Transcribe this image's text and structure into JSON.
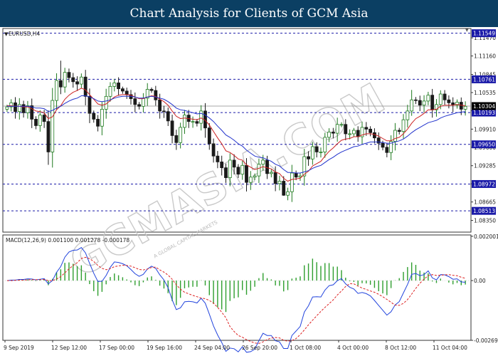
{
  "banner": {
    "title": "Chart Analysis for Clients of GCM Asia"
  },
  "watermark": {
    "text": "GCMASIA.COM",
    "subtext": "A GLOBAL CAPITAL MARKETS"
  },
  "chart_data": [
    {
      "type": "candlestick",
      "symbol_label": "EURUSD,H4",
      "ylim": [
        1.0815,
        1.1163
      ],
      "y_ticks": [
        1.1147,
        1.1116,
        1.10845,
        1.10535,
        1.10225,
        1.0991,
        1.096,
        1.09285,
        1.08975,
        1.08665,
        1.0835
      ],
      "y_tick_labels": [
        "1.11470",
        "1.11160",
        "1.10845",
        "1.10535",
        "1.10225",
        "1.09910",
        "1.09600",
        "1.09285",
        "1.08975",
        "1.08665",
        "1.08350"
      ],
      "levels": [
        {
          "value": 1.11549,
          "label": "1.11549"
        },
        {
          "value": 1.10761,
          "label": "1.10761"
        },
        {
          "value": 1.10193,
          "label": "1.10193"
        },
        {
          "value": 1.0965,
          "label": "1.09650"
        },
        {
          "value": 1.08972,
          "label": "1.08972"
        },
        {
          "value": 1.08513,
          "label": "1.08513"
        }
      ],
      "current_price": {
        "value": 1.10304,
        "label": "1.10304"
      },
      "x_labels": [
        "9 Sep 2019",
        "12 Sep 12:00",
        "17 Sep 00:00",
        "19 Sep 16:00",
        "24 Sep 04:00",
        "26 Sep 20:00",
        "1 Oct 08:00",
        "4 Oct 00:00",
        "8 Oct 12:00",
        "11 Oct 04:00"
      ],
      "closes": [
        1.1029,
        1.1036,
        1.1021,
        1.1033,
        1.1019,
        1.1031,
        1.1008,
        1.0997,
        1.1015,
        1.1004,
        1.0952,
        1.104,
        1.1074,
        1.1063,
        1.1088,
        1.1079,
        1.1072,
        1.1068,
        1.108,
        1.1047,
        1.1018,
        1.1008,
        1.0996,
        1.1025,
        1.1047,
        1.1064,
        1.107,
        1.106,
        1.1056,
        1.105,
        1.1043,
        1.1033,
        1.103,
        1.1044,
        1.1059,
        1.1057,
        1.1041,
        1.1022,
        1.1021,
        1.1005,
        1.098,
        1.0968,
        1.0994,
        1.1015,
        1.1004,
        1.1004,
        1.1001,
        1.1022,
        1.0993,
        1.0966,
        1.0945,
        1.0935,
        1.0925,
        1.0908,
        1.0938,
        1.0926,
        1.0914,
        1.0929,
        1.09,
        1.0909,
        1.0911,
        1.0931,
        1.0938,
        1.0915,
        1.0917,
        1.0898,
        1.0902,
        1.0878,
        1.0884,
        1.0916,
        1.0909,
        1.0911,
        1.0944,
        1.094,
        1.0961,
        1.0952,
        1.0952,
        1.0977,
        1.0986,
        1.0984,
        1.0999,
        1.0999,
        1.0983,
        1.0983,
        1.0989,
        1.0978,
        1.0994,
        1.0991,
        1.0985,
        1.0976,
        1.0967,
        1.096,
        1.0951,
        1.097,
        1.0989,
        1.0987,
        1.1007,
        1.1022,
        1.1041,
        1.104,
        1.1032,
        1.1039,
        1.1049,
        1.1024,
        1.1033,
        1.1051,
        1.1041,
        1.1036,
        1.1032,
        1.1037,
        1.1025,
        1.103
      ],
      "series": [
        {
          "name": "",
          "type": "moving-average",
          "color": "#cc2222",
          "values": [
            1.1031,
            1.1031,
            1.103,
            1.103,
            1.1029,
            1.1029,
            1.1026,
            1.1022,
            1.1021,
            1.1019,
            1.1009,
            1.1012,
            1.1024,
            1.1031,
            1.1042,
            1.1049,
            1.1054,
            1.1057,
            1.1061,
            1.1058,
            1.105,
            1.1042,
            1.1034,
            1.1032,
            1.1034,
            1.104,
            1.1046,
            1.1049,
            1.105,
            1.105,
            1.1049,
            1.1046,
            1.1043,
            1.1043,
            1.1046,
            1.1048,
            1.1047,
            1.1042,
            1.1038,
            1.1032,
            1.1022,
            1.1013,
            1.1009,
            1.101,
            1.1009,
            1.1008,
            1.1007,
            1.101,
            1.1006,
            1.0998,
            1.0987,
            1.0976,
            1.0966,
            1.0954,
            1.0951,
            1.0946,
            1.094,
            1.0938,
            1.093,
            1.0926,
            1.0922,
            1.0924,
            1.0927,
            1.0925,
            1.0923,
            1.0918,
            1.0915,
            1.0907,
            1.0902,
            1.0905,
            1.0906,
            1.0907,
            1.0914,
            1.0919,
            1.0928,
            1.0932,
            1.0936,
            1.0945,
            1.0953,
            1.0959,
            1.0966,
            1.0972,
            1.0974,
            1.0975,
            1.0978,
            1.0978,
            1.0981,
            1.0983,
            1.0983,
            1.0982,
            1.0979,
            1.0975,
            1.0971,
            1.0971,
            1.0975,
            1.0977,
            1.0983,
            1.0991,
            1.1001,
            1.1009,
            1.1013,
            1.1018,
            1.1024,
            1.1024,
            1.1025,
            1.103,
            1.1032,
            1.1032,
            1.1032,
            1.1033,
            1.1032,
            1.1031
          ]
        },
        {
          "name": "",
          "type": "moving-average",
          "color": "#2233cc",
          "values": [
            1.103,
            1.103,
            1.103,
            1.103,
            1.103,
            1.103,
            1.1029,
            1.1027,
            1.1027,
            1.1026,
            1.1021,
            1.1023,
            1.1027,
            1.103,
            1.1035,
            1.1039,
            1.1042,
            1.1044,
            1.1048,
            1.1048,
            1.1046,
            1.1043,
            1.1039,
            1.1038,
            1.1039,
            1.1041,
            1.1044,
            1.1046,
            1.1047,
            1.1047,
            1.1047,
            1.1046,
            1.1044,
            1.1044,
            1.1046,
            1.1047,
            1.1046,
            1.1044,
            1.1042,
            1.1038,
            1.1033,
            1.1027,
            1.1024,
            1.1023,
            1.1021,
            1.1019,
            1.1017,
            1.1018,
            1.1015,
            1.101,
            1.1004,
            1.0996,
            1.0989,
            1.0981,
            1.0977,
            1.0972,
            1.0966,
            1.0962,
            1.0955,
            1.095,
            1.0945,
            1.0943,
            1.0942,
            1.0939,
            1.0936,
            1.0931,
            1.0928,
            1.0922,
            1.0917,
            1.0917,
            1.0916,
            1.0916,
            1.0918,
            1.092,
            1.0924,
            1.0927,
            1.0929,
            1.0934,
            1.0939,
            1.0943,
            1.0948,
            1.0952,
            1.0955,
            1.0958,
            1.0961,
            1.0962,
            1.0965,
            1.0967,
            1.0969,
            1.0969,
            1.0969,
            1.0968,
            1.0967,
            1.0967,
            1.0969,
            1.0971,
            1.0974,
            1.0979,
            1.0985,
            1.099,
            1.0994,
            1.0998,
            1.1002,
            1.1004,
            1.1006,
            1.101,
            1.1013,
            1.1015,
            1.1017,
            1.1019,
            1.102,
            1.1021
          ]
        }
      ]
    },
    {
      "type": "macd",
      "label": "MACD(12,26,9) 0.001100 0.001278 -0.000178",
      "ylim": [
        -0.0027,
        0.00206
      ],
      "y_ticks": [
        0.002001,
        0.0,
        -0.002699
      ],
      "y_tick_labels": [
        "0.002001",
        "0.00",
        "-0.002699"
      ],
      "histogram": [
        0.0,
        2e-05,
        1e-05,
        4e-05,
        2e-05,
        5e-05,
        3e-05,
        -2e-05,
        3e-05,
        4e-05,
        -0.00021,
        8e-05,
        0.00038,
        0.00051,
        0.0008,
        0.00082,
        0.00076,
        0.00065,
        0.00069,
        0.00036,
        -0.00016,
        -0.00048,
        -0.00069,
        -0.00051,
        -0.00017,
        0.00016,
        0.00032,
        0.00024,
        0.00015,
        5e-05,
        -8e-05,
        -0.00021,
        -0.00025,
        -8e-05,
        0.00014,
        0.00019,
        3e-05,
        -0.00023,
        -0.00036,
        -0.00057,
        -0.00093,
        -0.00111,
        -0.00078,
        -0.00035,
        -0.00031,
        -0.00028,
        -0.00028,
        1e-05,
        -0.00022,
        -0.00066,
        -0.00105,
        -0.00121,
        -0.0013,
        -0.00142,
        -0.00092,
        -0.0008,
        -0.00076,
        -0.00043,
        -0.00064,
        -0.00046,
        -0.00028,
        0.00011,
        0.00034,
        0.00011,
        5e-05,
        -0.00022,
        -0.00024,
        -0.00049,
        -0.00043,
        9e-05,
        0.00013,
        0.00019,
        0.00069,
        0.00077,
        0.00099,
        0.00083,
        0.00066,
        0.00079,
        0.00079,
        0.00063,
        0.00063,
        0.00047,
        0.00013,
        -3e-05,
        -6e-05,
        -0.00022,
        -0.00012,
        -0.00013,
        -0.00019,
        -0.00033,
        -0.00048,
        -0.00058,
        -0.00066,
        -0.00034,
        1e-05,
        0.00011,
        0.00039,
        0.00061,
        0.00082,
        0.00071,
        0.00045,
        0.00036,
        0.00033,
        -4e-05,
        -0.00011,
        9e-05,
        0.0,
        -9e-05,
        -0.00017,
        -0.00011,
        -0.00021,
        -0.00018
      ],
      "series": [
        {
          "name": "",
          "color": "#2244dd",
          "values": [
            0.0,
            2e-05,
            2e-05,
            5e-05,
            5e-05,
            8e-05,
            7e-05,
            3e-05,
            6e-05,
            9e-05,
            -0.00015,
            0.0,
            0.00037,
            0.00063,
            0.00106,
            0.00129,
            0.00137,
            0.00138,
            0.00149,
            0.00125,
            0.00077,
            0.00033,
            -4e-05,
            -3e-05,
            0.00023,
            0.0006,
            0.00084,
            0.00082,
            0.00076,
            0.00067,
            0.0005,
            0.00031,
            0.00019,
            0.00028,
            0.00052,
            0.00065,
            0.00055,
            0.00026,
            3e-05,
            -0.00032,
            -0.00087,
            -0.00131,
            -0.00123,
            -0.00096,
            -0.00094,
            -0.00096,
            -0.00101,
            -0.0008,
            -0.00102,
            -0.00152,
            -0.00205,
            -0.00246,
            -0.0028,
            -0.0032,
            -0.00305,
            -0.00308,
            -0.00322,
            -0.00299,
            -0.00324,
            -0.00321,
            -0.0031,
            -0.00272,
            -0.00238,
            -0.00248,
            -0.00248,
            -0.00272,
            -0.00277,
            -0.00307,
            -0.00307,
            -0.00248,
            -0.00228,
            -0.00207,
            -0.00142,
            -0.00114,
            -0.00074,
            -0.00073,
            -0.00074,
            -0.00043,
            -0.00023,
            -0.00019,
            0.0,
            9e-05,
            -0.00015,
            -0.0003,
            -0.00038,
            -0.00058,
            -0.00054,
            -0.00059,
            -0.00069,
            -0.0009,
            -0.00112,
            -0.00134,
            -0.00156,
            -0.00141,
            -0.0011,
            -0.00095,
            -0.00056,
            -0.00018,
            0.00028,
            0.00032,
            0.00022,
            0.00027,
            0.00044,
            0.00012,
            3e-05,
            0.00027,
            0.00026,
            0.00018,
            6e-05,
            8e-05,
            -6e-05,
            -8e-05
          ]
        },
        {
          "name": "",
          "color": "#dd2222",
          "dashed": true,
          "values": [
            0.0,
            0.0,
            1e-05,
            2e-05,
            2e-05,
            3e-05,
            4e-05,
            4e-05,
            4e-05,
            5e-05,
            0.0,
            0.0,
            7e-05,
            0.00018,
            0.00035,
            0.00053,
            0.00068,
            0.00081,
            0.001,
            0.00105,
            0.00099,
            0.00086,
            0.00068,
            0.00055,
            0.00049,
            0.00054,
            0.00063,
            0.00066,
            0.00069,
            0.00068,
            0.00065,
            0.00058,
            0.0005,
            0.00048,
            0.00052,
            0.00059,
            0.00061,
            0.00048,
            0.00038,
            0.00025,
            6e-05,
            -0.00019,
            -0.00039,
            -0.00053,
            -0.0006,
            -0.00067,
            -0.00073,
            -0.00079,
            -0.00082,
            -0.0009,
            -0.00102,
            -0.00121,
            -0.00143,
            -0.00168,
            -0.00208,
            -0.0023,
            -0.00248,
            -0.00256,
            -0.00267,
            -0.00275,
            -0.00282,
            -0.00284,
            -0.00277,
            -0.00266,
            -0.0026,
            -0.00257,
            -0.00259,
            -0.0027,
            -0.00274,
            -0.00271,
            -0.00262,
            -0.00244,
            -0.00223,
            -0.002,
            -0.00179,
            -0.00159,
            -0.00139,
            -0.00121,
            -0.00104,
            -0.00087,
            -0.00065,
            -0.00047,
            -0.00027,
            -0.00014,
            -0.00015,
            -0.00025,
            -0.00034,
            -0.0004,
            -0.00047,
            -0.00053,
            -0.00062,
            -0.00073,
            -0.00085,
            -0.00098,
            -0.00111,
            -0.00112,
            -0.00103,
            -0.00086,
            -0.00061,
            -0.00035,
            -0.00012,
            7e-05,
            0.00022,
            0.00027,
            0.00023,
            0.00024,
            0.00026,
            0.00027,
            0.00024,
            0.00022,
            0.00015,
            0.0001
          ]
        }
      ]
    }
  ]
}
